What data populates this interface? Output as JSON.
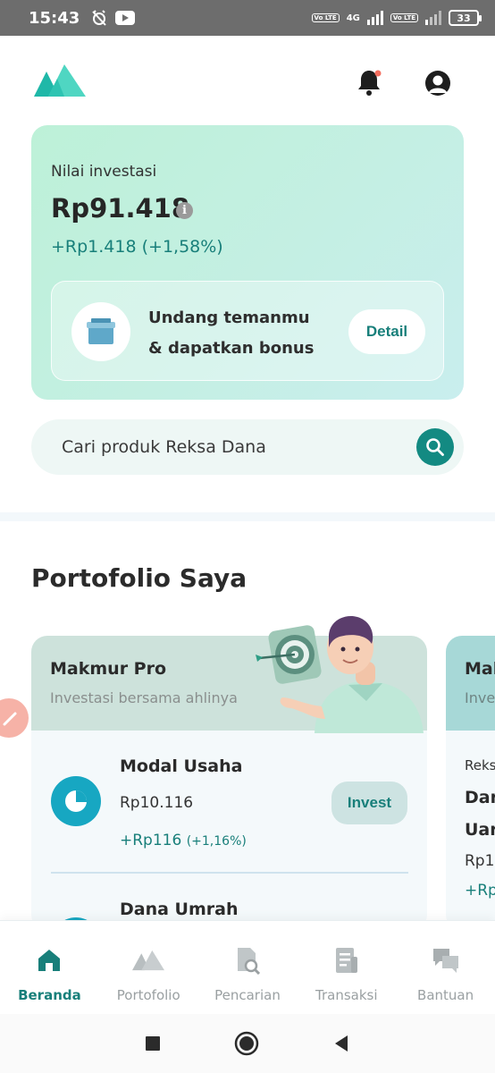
{
  "status_bar": {
    "time": "15:43",
    "network_label": "4G",
    "volte_label": "Vo LTE",
    "battery_level": "33"
  },
  "header": {
    "logo_icon": "makmur-logo-icon",
    "notification_icon": "bell-icon",
    "notification_badge_color": "#f36d5e",
    "profile_icon": "user-circle-icon"
  },
  "investment": {
    "label": "Nilai investasi",
    "amount": "Rp91.418",
    "info_icon": "i",
    "gain": "+Rp1.418 (+1,58%)",
    "referral": {
      "text_line1": "Undang temanmu",
      "text_line2": "& dapatkan bonus",
      "detail_label": "Detail",
      "icon": "gift-box-icon"
    }
  },
  "search": {
    "placeholder": "Cari produk Reksa Dana",
    "icon": "search-icon"
  },
  "portfolio": {
    "section_title": "Portofolio Saya",
    "cards": [
      {
        "name": "Makmur Pro",
        "tagline": "Investasi bersama ahlinya",
        "funds": [
          {
            "name": "Modal Usaha",
            "value": "Rp10.116",
            "gain": "+Rp116",
            "gain_pct": "(+1,16%)",
            "invest_label": "Invest",
            "icon": "pie-chart-icon"
          },
          {
            "name": "Dana Umrah"
          }
        ]
      },
      {
        "name": "Mak",
        "tagline": "Inve",
        "line1": "Reks",
        "line2": "Dar",
        "line3": "Uar",
        "line4": "Rp1",
        "line5": "+Rp"
      }
    ]
  },
  "bottom_nav": {
    "items": [
      {
        "label": "Beranda",
        "icon": "home-icon",
        "active": true
      },
      {
        "label": "Portofolio",
        "icon": "mountains-icon",
        "active": false
      },
      {
        "label": "Pencarian",
        "icon": "document-search-icon",
        "active": false
      },
      {
        "label": "Transaksi",
        "icon": "receipt-icon",
        "active": false
      },
      {
        "label": "Bantuan",
        "icon": "chat-bubbles-icon",
        "active": false
      }
    ]
  },
  "colors": {
    "accent": "#187f7a",
    "accent_dark": "#138a82",
    "card_gradient_start": "#bdf1d8",
    "card_gradient_end": "#c9eeee"
  }
}
